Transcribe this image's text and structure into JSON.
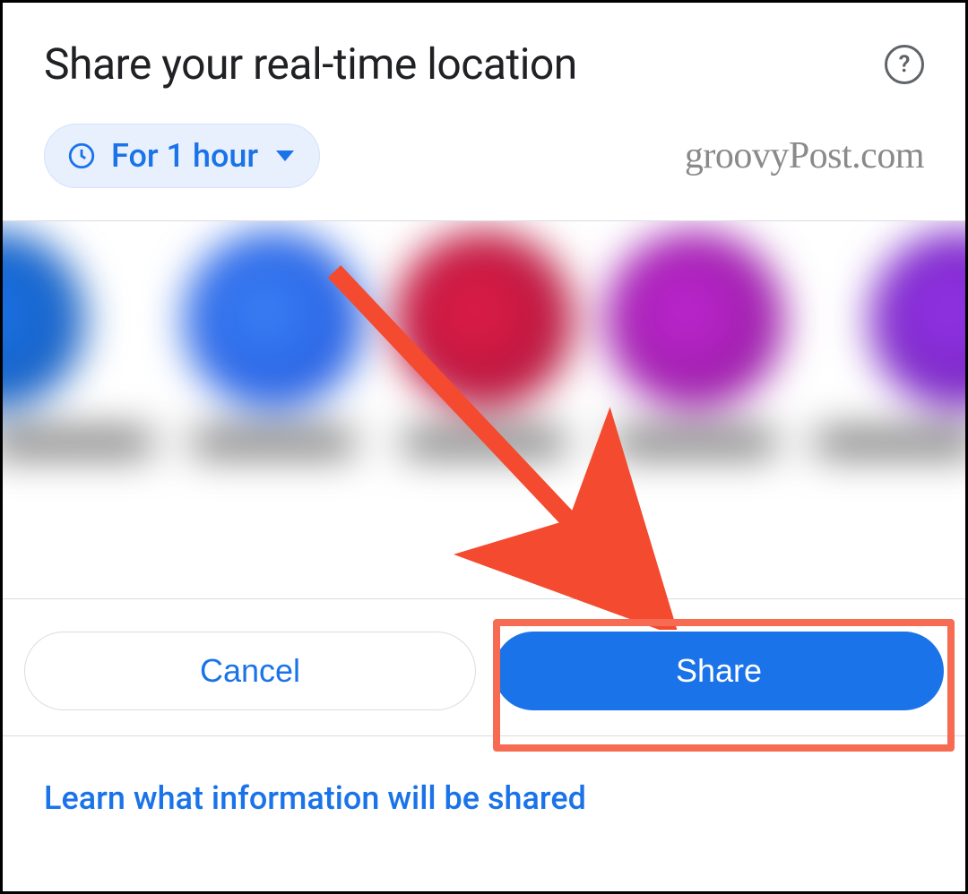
{
  "header": {
    "title": "Share your real-time location"
  },
  "duration_chip": {
    "label": "For 1 hour"
  },
  "watermark": {
    "text": "groovyPost.com"
  },
  "actions": {
    "cancel_label": "Cancel",
    "share_label": "Share"
  },
  "footer": {
    "learn_link": "Learn what information will be shared"
  },
  "colors": {
    "accent": "#1a73e8",
    "highlight": "#f76b52"
  }
}
